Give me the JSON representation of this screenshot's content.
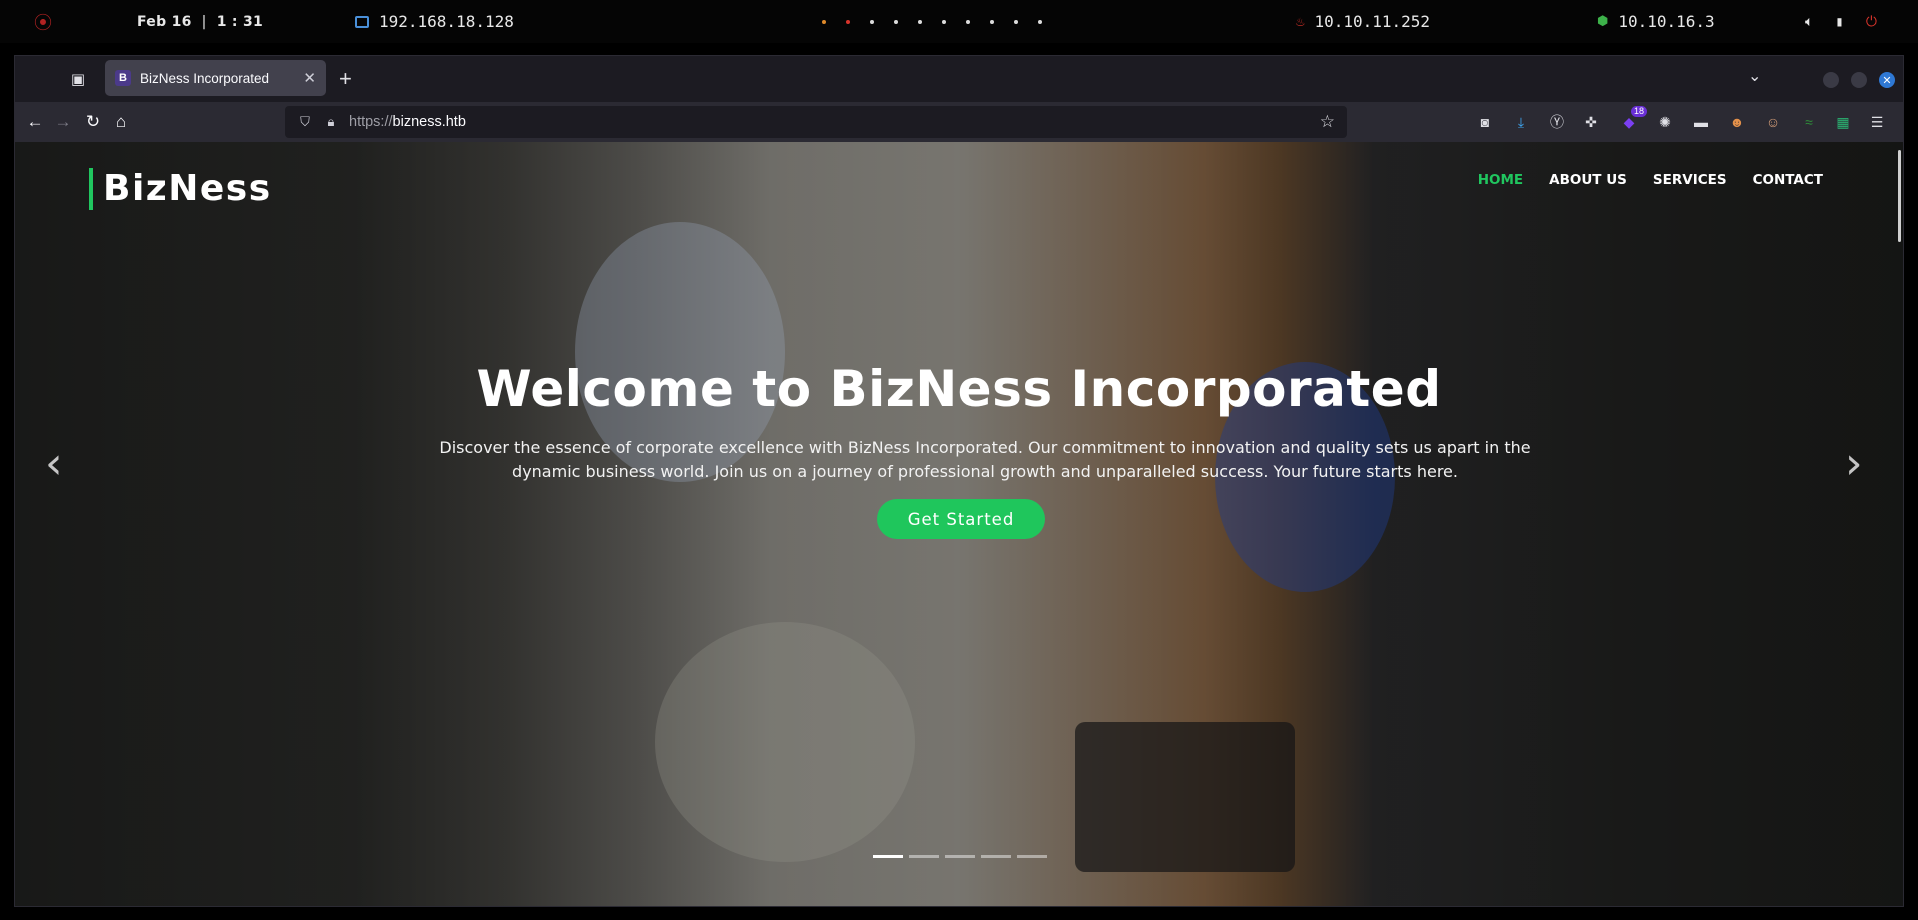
{
  "system_bar": {
    "date": "Feb 16",
    "time": "1 : 31",
    "ip_local": "192.168.18.128",
    "ip_target": "10.10.11.252",
    "ip_vpn": "10.10.16.3"
  },
  "browser": {
    "tab_title": "BizNess Incorporated",
    "tab_favicon_letter": "B",
    "url_protocol": "https://",
    "url_host": "bizness.htb",
    "extension_badge": "18"
  },
  "site": {
    "logo": "BizNess",
    "menu": [
      "HOME",
      "ABOUT US",
      "SERVICES",
      "CONTACT"
    ],
    "hero_title": "Welcome to BizNess Incorporated",
    "hero_text": "Discover the essence of corporate excellence with BizNess Incorporated. Our commitment to innovation and quality sets us apart in the dynamic business world. Join us on a journey of professional growth and unparalleled success. Your future starts here.",
    "cta_label": "Get Started",
    "accent_color": "#20c65f"
  }
}
